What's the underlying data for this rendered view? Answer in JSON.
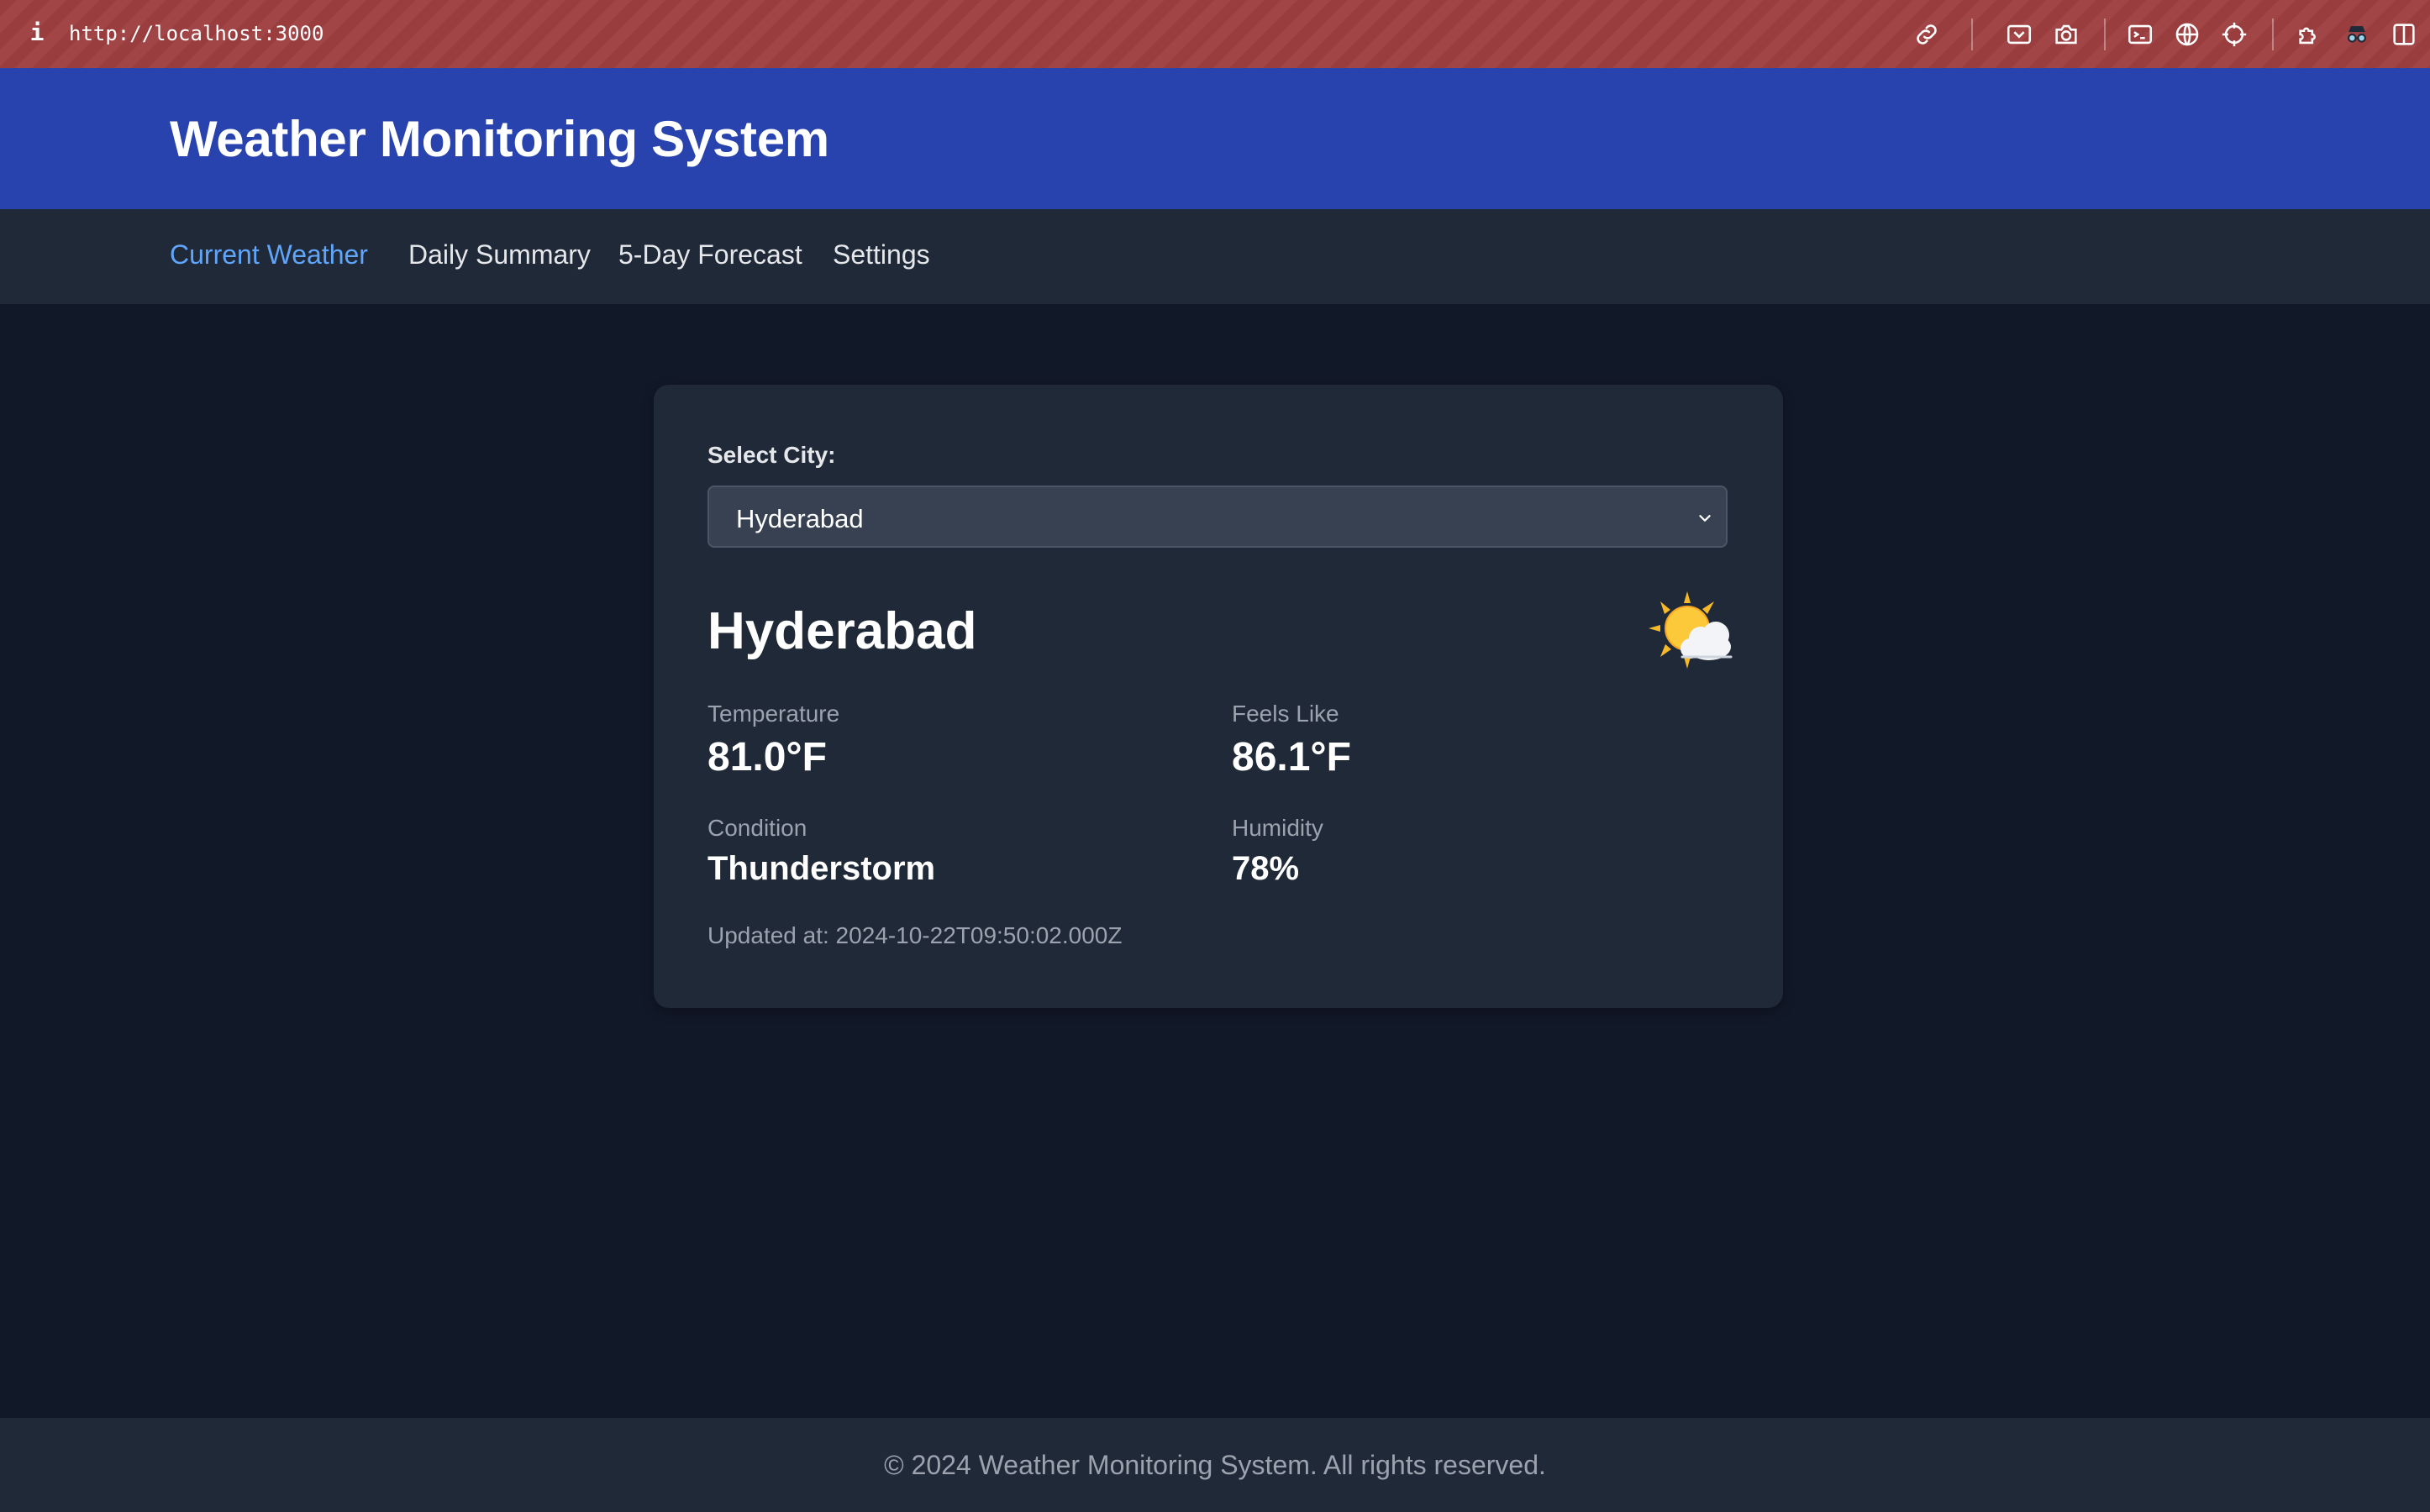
{
  "browser": {
    "url": "http://localhost:3000",
    "info_label": "i"
  },
  "header": {
    "title": "Weather Monitoring System"
  },
  "nav": {
    "items": [
      {
        "label": "Current Weather",
        "active": true
      },
      {
        "label": "Daily Summary",
        "active": false
      },
      {
        "label": "5-Day Forecast",
        "active": false
      },
      {
        "label": "Settings",
        "active": false
      }
    ]
  },
  "card": {
    "select_label": "Select City:",
    "selected_city": "Hyderabad",
    "city_name": "Hyderabad",
    "weather_icon": "sun-behind-cloud-icon",
    "temperature": {
      "label": "Temperature",
      "value": "81.0°F"
    },
    "feels_like": {
      "label": "Feels Like",
      "value": "86.1°F"
    },
    "condition": {
      "label": "Condition",
      "value": "Thunderstorm"
    },
    "humidity": {
      "label": "Humidity",
      "value": "78%"
    },
    "updated": "Updated at: 2024-10-22T09:50:02.000Z"
  },
  "footer": {
    "text": "© 2024 Weather Monitoring System. All rights reserved."
  },
  "colors": {
    "header_bg": "#2842ae",
    "nav_bg": "#1f2937",
    "page_bg": "#111827",
    "active_nav": "#60a5fa",
    "browser_bar": "#9a3d3f"
  }
}
